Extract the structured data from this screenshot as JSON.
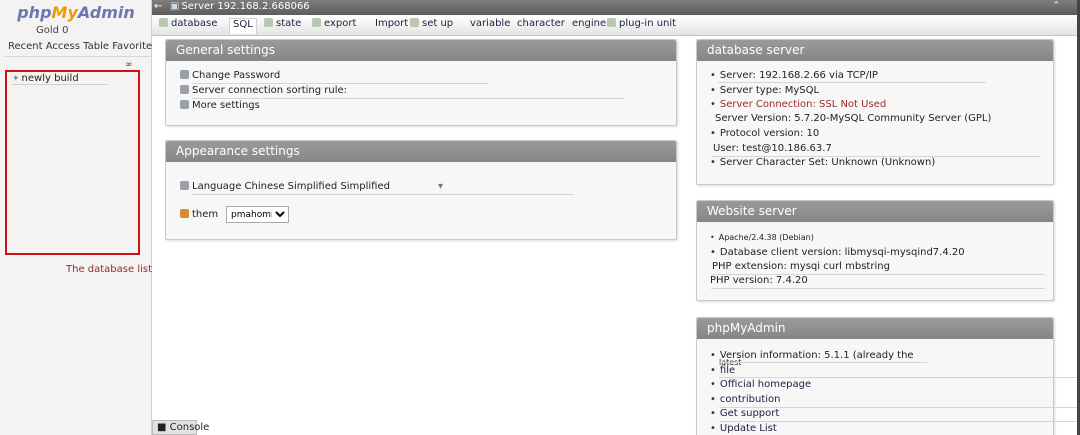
{
  "nav": {
    "logo_php": "php",
    "logo_my": "My",
    "logo_admin": "Admin",
    "user": "Gold 0",
    "tabs_text": "Recent Access Table Favorites",
    "link_icon": "link-icon",
    "tree_item": "newly build",
    "annotation": "The database list is blank"
  },
  "topbar": {
    "crumb": "Server 192.168.2.668066"
  },
  "menu": {
    "items": [
      "database",
      "SQL",
      "state",
      "export",
      "Import",
      "set up",
      "variable",
      "character",
      "engine",
      "plug-in unit"
    ]
  },
  "general": {
    "title": "General settings",
    "change_password": "Change Password",
    "collation": "Server connection sorting rule:",
    "more": "More settings"
  },
  "appearance": {
    "title": "Appearance settings",
    "language_label": "Language Chinese Simplified Simplified",
    "theme_label": "them",
    "theme_value": "pmahomme"
  },
  "db_server": {
    "title": "database server",
    "items": [
      "Server: 192.168.2.66 via TCP/IP",
      "Server type: MySQL",
      "Server Connection: SSL Not Used",
      "Server Version: 5.7.20-MySQL Community Server (GPL)",
      "Protocol version: 10",
      "User: test@10.186.63.7",
      "Server Character Set: Unknown (Unknown)"
    ]
  },
  "web_server": {
    "title": "Website server",
    "items": [
      "Apache/2.4.38 (Debian)",
      "Database client version: libmysqi-mysqind7.4.20",
      "PHP extension: mysqi curl mbstring",
      "PHP version: 7.4.20"
    ]
  },
  "pma": {
    "title": "phpMyAdmin",
    "items": [
      "Version information: 5.1.1 (already the",
      "latest",
      "file",
      "Official homepage",
      "contribution",
      "Get support",
      "Update List"
    ]
  },
  "console": "Console",
  "colors": {
    "panel_header": "#8f8f8f",
    "annotation_red": "#d01010",
    "link_blue": "#224"
  }
}
